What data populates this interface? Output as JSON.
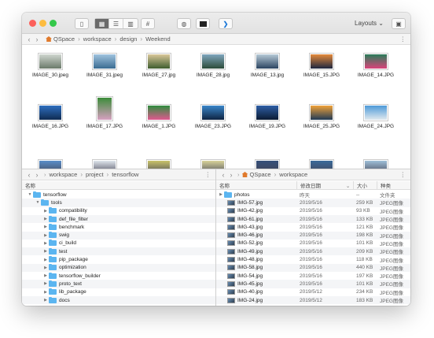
{
  "toolbar": {
    "layouts_label": "Layouts",
    "view_icons": [
      "sidebar-icon",
      "icon-view-icon",
      "list-view-icon",
      "column-view-icon",
      "hash-icon"
    ],
    "extra_icons": [
      "network-icon",
      "terminal-icon",
      "vscode-icon"
    ]
  },
  "top_path": {
    "items": [
      "QSpace",
      "workspace",
      "design",
      "Weekend"
    ]
  },
  "top_files": [
    {
      "name": "IMAGE_30.jpeg",
      "c1": "#cfd6cf",
      "c2": "#6b7a6a"
    },
    {
      "name": "IMAGE_31.jpeg",
      "c1": "#9fc3de",
      "c2": "#3b6c92"
    },
    {
      "name": "IMAGE_27.jpg",
      "c1": "#d9c799",
      "c2": "#3f5d2f"
    },
    {
      "name": "IMAGE_28.jpg",
      "c1": "#7fa6bd",
      "c2": "#2c4c39"
    },
    {
      "name": "IMAGE_13.jpg",
      "c1": "#b6c9d6",
      "c2": "#2b4460"
    },
    {
      "name": "IMAGE_15.JPG",
      "c1": "#e38a3b",
      "c2": "#1d2740"
    },
    {
      "name": "IMAGE_14.JPG",
      "c1": "#2a7c5a",
      "c2": "#d9437a"
    },
    {
      "name": "IMAGE_16.JPG",
      "c1": "#2f6fbf",
      "c2": "#0f2b52"
    },
    {
      "name": "IMAGE_17.JPG",
      "c1": "#3c8c3a",
      "c2": "#d6a0c0"
    },
    {
      "name": "IMAGE_1.JPG",
      "c1": "#2f8d3e",
      "c2": "#e0588f"
    },
    {
      "name": "IMAGE_23.JPG",
      "c1": "#3a86c9",
      "c2": "#0e2442"
    },
    {
      "name": "IMAGE_19.JPG",
      "c1": "#2e5fa6",
      "c2": "#0c1b33"
    },
    {
      "name": "IMAGE_25.JPG",
      "c1": "#f0a23a",
      "c2": "#203a55"
    },
    {
      "name": "IMAGE_24.JPG",
      "c1": "#4e9ad8",
      "c2": "#dfe8ee"
    }
  ],
  "left_path": {
    "items": [
      "workspace",
      "project",
      "tensorflow"
    ]
  },
  "left_header": {
    "name": "名称"
  },
  "left_tree": [
    {
      "label": "tensorflow",
      "level": 0,
      "open": true
    },
    {
      "label": "tools",
      "level": 1,
      "open": true
    },
    {
      "label": "compatibility",
      "level": 2,
      "open": false
    },
    {
      "label": "def_file_filter",
      "level": 2,
      "open": false
    },
    {
      "label": "benchmark",
      "level": 2,
      "open": false
    },
    {
      "label": "swig",
      "level": 2,
      "open": false
    },
    {
      "label": "ci_build",
      "level": 2,
      "open": false
    },
    {
      "label": "test",
      "level": 2,
      "open": false
    },
    {
      "label": "pip_package",
      "level": 2,
      "open": false
    },
    {
      "label": "optimization",
      "level": 2,
      "open": false
    },
    {
      "label": "tensorflow_builder",
      "level": 2,
      "open": false
    },
    {
      "label": "proto_text",
      "level": 2,
      "open": false
    },
    {
      "label": "lib_package",
      "level": 2,
      "open": false
    },
    {
      "label": "docs",
      "level": 2,
      "open": false
    }
  ],
  "right_path": {
    "items": [
      "QSpace",
      "workspace"
    ]
  },
  "right_header": {
    "name": "名称",
    "date": "修改日期",
    "size": "大小",
    "kind": "种类"
  },
  "right_rows": [
    {
      "name": "photos",
      "date": "昨天",
      "size": "--",
      "kind": "文件夹",
      "folder": true
    },
    {
      "name": "IMG-57.jpg",
      "date": "2019/5/16",
      "size": "259 KB",
      "kind": "JPEG图像"
    },
    {
      "name": "IMG-42.jpg",
      "date": "2019/5/16",
      "size": "93 KB",
      "kind": "JPEG图像"
    },
    {
      "name": "IMG-61.jpg",
      "date": "2019/5/16",
      "size": "133 KB",
      "kind": "JPEG图像"
    },
    {
      "name": "IMG-43.jpg",
      "date": "2019/5/16",
      "size": "121 KB",
      "kind": "JPEG图像"
    },
    {
      "name": "IMG-46.jpg",
      "date": "2019/5/16",
      "size": "198 KB",
      "kind": "JPEG图像"
    },
    {
      "name": "IMG-52.jpg",
      "date": "2019/5/16",
      "size": "101 KB",
      "kind": "JPEG图像"
    },
    {
      "name": "IMG-49.jpg",
      "date": "2019/5/16",
      "size": "209 KB",
      "kind": "JPEG图像"
    },
    {
      "name": "IMG-48.jpg",
      "date": "2019/5/16",
      "size": "118 KB",
      "kind": "JPEG图像"
    },
    {
      "name": "IMG-58.jpg",
      "date": "2019/5/16",
      "size": "440 KB",
      "kind": "JPEG图像"
    },
    {
      "name": "IMG-54.jpg",
      "date": "2019/5/16",
      "size": "197 KB",
      "kind": "JPEG图像"
    },
    {
      "name": "IMG-45.jpg",
      "date": "2019/5/16",
      "size": "101 KB",
      "kind": "JPEG图像"
    },
    {
      "name": "IMG-40.jpg",
      "date": "2019/5/12",
      "size": "234 KB",
      "kind": "JPEG图像"
    },
    {
      "name": "IMG-24.jpg",
      "date": "2019/5/12",
      "size": "183 KB",
      "kind": "JPEG图像"
    }
  ],
  "colors": {
    "folder": "#5bb5f0",
    "home": "#e07a2c"
  }
}
